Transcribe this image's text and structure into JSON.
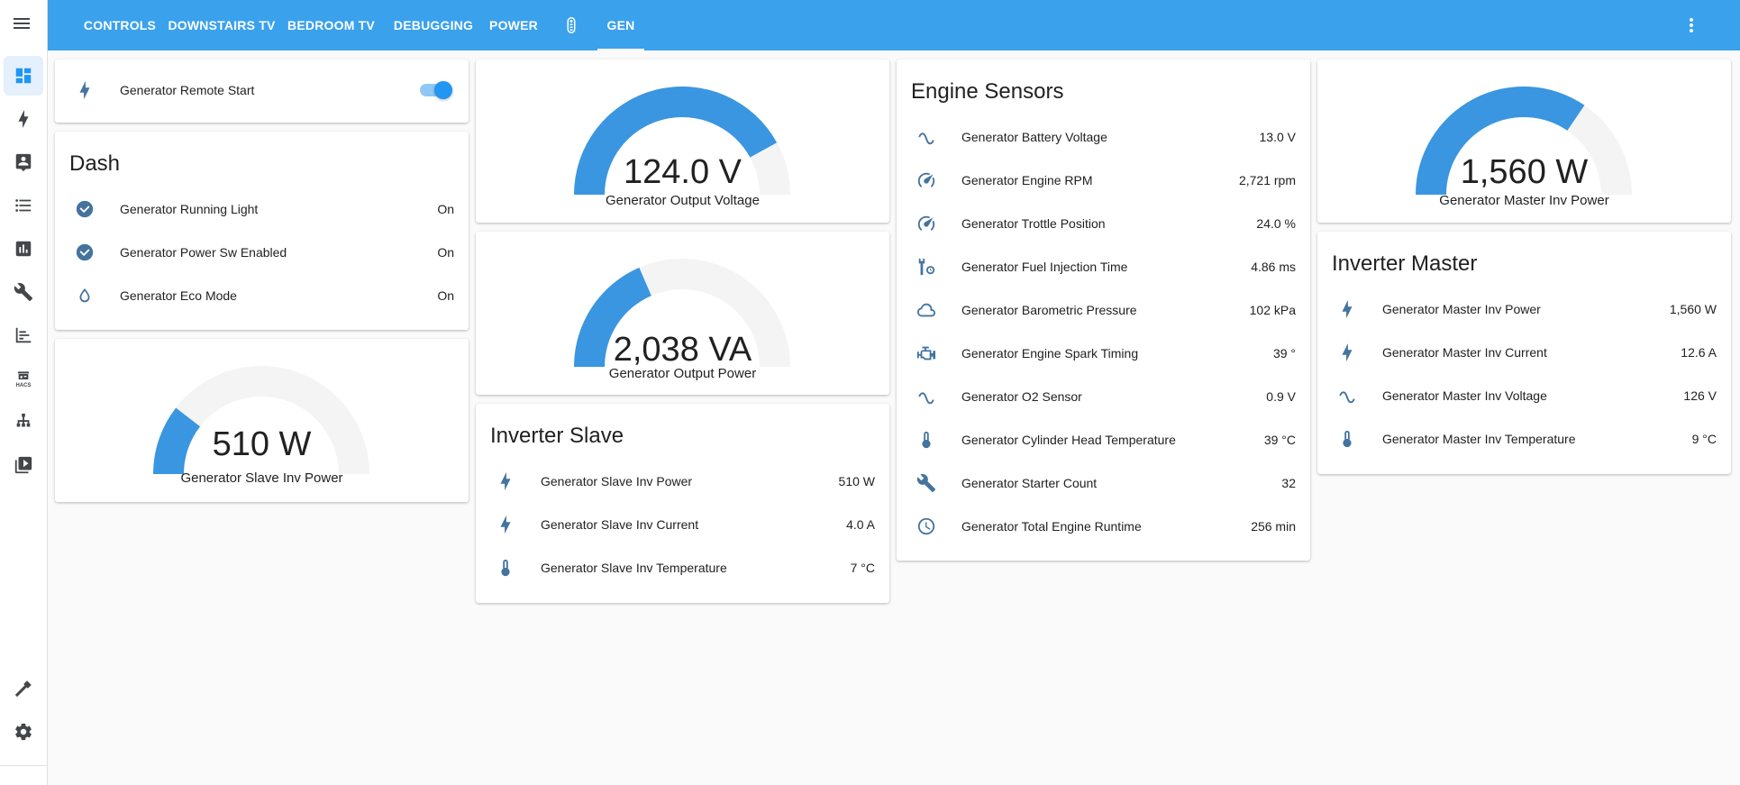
{
  "tabs": [
    {
      "label": "CONTROLS"
    },
    {
      "label": "DOWNSTAIRS TV"
    },
    {
      "label": "BEDROOM TV"
    },
    {
      "label": "DEBUGGING"
    },
    {
      "label": "POWER"
    },
    {
      "label": "",
      "icon": "remote-icon"
    },
    {
      "label": "GEN",
      "active": true
    }
  ],
  "colors": {
    "header": "#3aa1ec",
    "accent": "#2196f3",
    "gauge_fill": "#3a96e0",
    "gauge_track": "#f4f4f4",
    "icon": "#44739e"
  },
  "remote_start": {
    "label": "Generator Remote Start",
    "icon": "flash-icon",
    "state": "on"
  },
  "dash": {
    "title": "Dash",
    "rows": [
      {
        "icon": "check-circle-icon",
        "label": "Generator Running Light",
        "value": "On"
      },
      {
        "icon": "check-circle-icon",
        "label": "Generator Power Sw Enabled",
        "value": "On"
      },
      {
        "icon": "water-drop-icon",
        "label": "Generator Eco Mode",
        "value": "On"
      }
    ]
  },
  "gauges": {
    "slave_power": {
      "value_text": "510 W",
      "name": "Generator Slave Inv Power",
      "fraction": 0.21
    },
    "output_voltage": {
      "value_text": "124.0 V",
      "name": "Generator Output Voltage",
      "fraction": 0.84
    },
    "output_power": {
      "value_text": "2,038 VA",
      "name": "Generator Output Power",
      "fraction": 0.37
    },
    "master_power": {
      "value_text": "1,560 W",
      "name": "Generator Master Inv Power",
      "fraction": 0.69
    }
  },
  "inverter_slave": {
    "title": "Inverter Slave",
    "rows": [
      {
        "icon": "flash-icon",
        "label": "Generator Slave Inv Power",
        "value": "510 W"
      },
      {
        "icon": "flash-icon",
        "label": "Generator Slave Inv Current",
        "value": "4.0 A"
      },
      {
        "icon": "thermometer-icon",
        "label": "Generator Slave Inv Temperature",
        "value": "7 °C"
      }
    ]
  },
  "engine_sensors": {
    "title": "Engine Sensors",
    "rows": [
      {
        "icon": "sine-wave-icon",
        "label": "Generator Battery Voltage",
        "value": "13.0 V"
      },
      {
        "icon": "speedometer-icon",
        "label": "Generator Engine RPM",
        "value": "2,721 rpm"
      },
      {
        "icon": "speedometer-icon",
        "label": "Generator Trottle Position",
        "value": "24.0 %"
      },
      {
        "icon": "wrench-clock-icon",
        "label": "Generator Fuel Injection Time",
        "value": "4.86 ms"
      },
      {
        "icon": "cloud-icon",
        "label": "Generator Barometric Pressure",
        "value": "102 kPa"
      },
      {
        "icon": "engine-icon",
        "label": "Generator Engine Spark Timing",
        "value": "39 °"
      },
      {
        "icon": "sine-wave-icon",
        "label": "Generator O2 Sensor",
        "value": "0.9 V"
      },
      {
        "icon": "thermometer-icon",
        "label": "Generator Cylinder Head Temperature",
        "value": "39 °C"
      },
      {
        "icon": "wrench-icon",
        "label": "Generator Starter Count",
        "value": "32"
      },
      {
        "icon": "clock-icon",
        "label": "Generator Total Engine Runtime",
        "value": "256 min"
      }
    ]
  },
  "inverter_master": {
    "title": "Inverter Master",
    "rows": [
      {
        "icon": "flash-icon",
        "label": "Generator Master Inv Power",
        "value": "1,560 W"
      },
      {
        "icon": "flash-icon",
        "label": "Generator Master Inv Current",
        "value": "12.6 A"
      },
      {
        "icon": "sine-wave-icon",
        "label": "Generator Master Inv Voltage",
        "value": "126 V"
      },
      {
        "icon": "thermometer-icon",
        "label": "Generator Master Inv Temperature",
        "value": "9 °C"
      }
    ]
  },
  "sidebar": {
    "items": [
      {
        "icon": "dashboard-icon",
        "active": true
      },
      {
        "icon": "energy-icon"
      },
      {
        "icon": "map-icon"
      },
      {
        "icon": "logbook-icon"
      },
      {
        "icon": "history-icon"
      },
      {
        "icon": "wrench-icon"
      },
      {
        "icon": "chart-icon"
      },
      {
        "icon": "hacs-icon",
        "text": "HACS"
      },
      {
        "icon": "network-icon"
      },
      {
        "icon": "media-icon"
      },
      {
        "icon": "hammer-icon"
      },
      {
        "icon": "settings-icon"
      }
    ]
  }
}
